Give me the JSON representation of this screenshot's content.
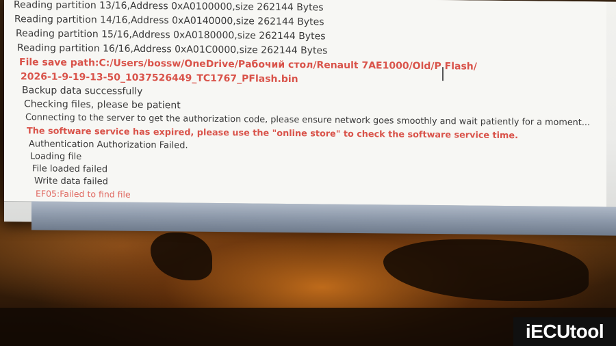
{
  "log": {
    "lines": [
      {
        "text": "Reading partition 13/16,Address 0xA0100000,size 262144 Bytes",
        "style": "normal"
      },
      {
        "text": "Reading partition 14/16,Address 0xA0140000,size 262144 Bytes",
        "style": "normal"
      },
      {
        "text": "Reading partition 15/16,Address 0xA0180000,size 262144 Bytes",
        "style": "normal"
      },
      {
        "text": "Reading partition 16/16,Address 0xA01C0000,size 262144 Bytes",
        "style": "normal"
      },
      {
        "text": "File save path:C:/Users/bossw/OneDrive/Рабочий стол/Renault 7AE1000/Old/P Flash/",
        "style": "error"
      },
      {
        "text": "2026-1-9-19-13-50_1037526449_TC1767_PFlash.bin",
        "style": "error"
      },
      {
        "text": "Backup data successfully",
        "style": "normal"
      },
      {
        "text": "Checking files, please be patient",
        "style": "normal"
      },
      {
        "text": "Connecting to the server to get the authorization code, please ensure network goes smoothly and wait patiently for a moment...",
        "style": "normal"
      },
      {
        "text": "The software service has expired, please use the \"online store\" to check the software service time.",
        "style": "error"
      },
      {
        "text": "Authentication Authorization Failed.",
        "style": "normal"
      },
      {
        "text": "Loading file",
        "style": "normal"
      },
      {
        "text": "File loaded failed",
        "style": "normal"
      },
      {
        "text": "Write data failed",
        "style": "normal"
      },
      {
        "text": "EF05:Failed to find file",
        "style": "error-light"
      }
    ]
  },
  "watermark": {
    "brand_prefix": "iECU",
    "brand_suffix": "tool",
    "brand_colors": {
      "text": "#ffffff",
      "accent": "#e5392e",
      "background": "#101010"
    }
  },
  "colors": {
    "error_text": "#d9534a",
    "normal_text": "#3a3a3a",
    "log_background": "#f7f7f4",
    "status_bar": "#8f9bac"
  }
}
